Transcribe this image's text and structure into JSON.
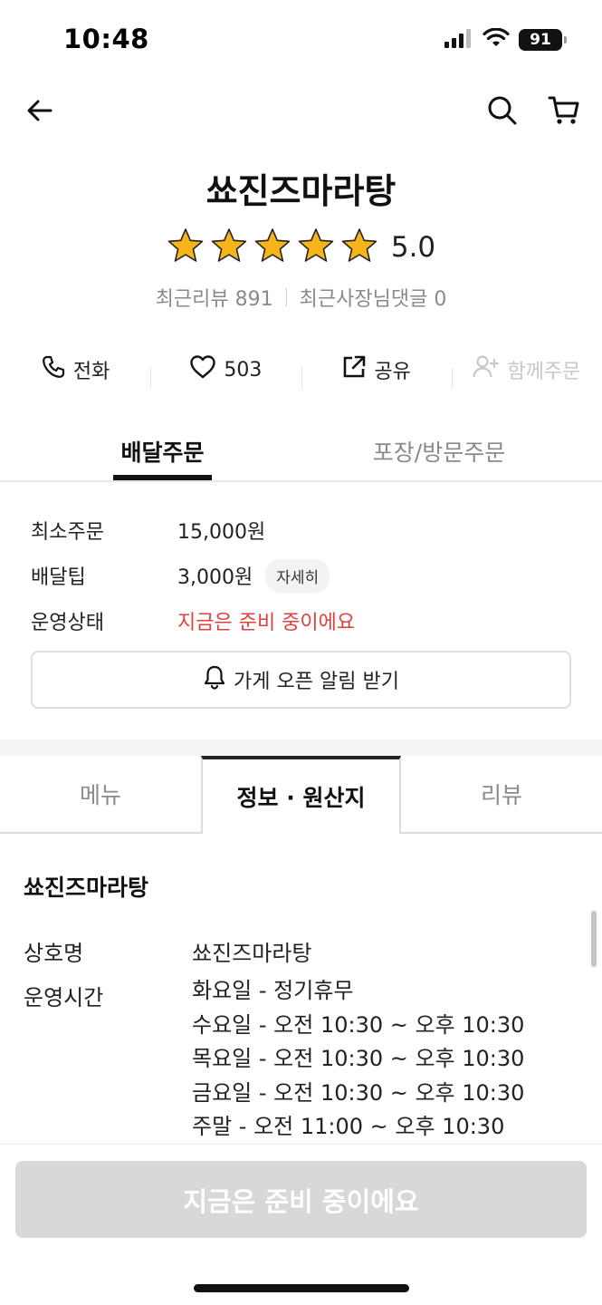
{
  "status_bar": {
    "time": "10:48",
    "battery": "91",
    "icons": [
      "signal-icon",
      "wifi-icon",
      "battery-icon"
    ]
  },
  "nav": {
    "icons": [
      "back-arrow-icon",
      "search-icon",
      "cart-icon"
    ]
  },
  "store": {
    "name": "쑈진즈마라탕",
    "rating": "5.0",
    "stars": 5,
    "recent_reviews_label": "최근리뷰 891",
    "owner_replies_label": "최근사장님댓글 0"
  },
  "actions": {
    "call": "전화",
    "likes": "503",
    "share": "공유",
    "group_order": "함께주문"
  },
  "order_tabs": {
    "delivery": "배달주문",
    "pickup": "포장/방문주문"
  },
  "order_info": {
    "min_order_label": "최소주문",
    "min_order_value": "15,000원",
    "delivery_tip_label": "배달팁",
    "delivery_tip_value": "3,000원",
    "detail_chip": "자세히",
    "status_label": "운영상태",
    "status_value": "지금은 준비 중이에요",
    "notify_button": "가게 오픈 알림 받기"
  },
  "content_tabs": {
    "menu": "메뉴",
    "info": "정보 · 원산지",
    "review": "리뷰"
  },
  "info_section": {
    "title": "쑈진즈마라탕",
    "business_name_label": "상호명",
    "business_name_value": "쑈진즈마라탕",
    "hours_label": "운영시간",
    "hours": [
      "화요일 - 정기휴무",
      "수요일 - 오전 10:30 ~ 오후 10:30",
      "목요일 - 오전 10:30 ~ 오후 10:30",
      "금요일 - 오전 10:30 ~ 오후 10:30",
      "주말 - 오전 11:00 ~ 오후 10:30"
    ]
  },
  "bottom_cta": {
    "label": "지금은 준비 중이에요"
  },
  "colors": {
    "accent_red": "#e0413c",
    "star_yellow": "#f7b51c",
    "disabled_gray": "#d6d8da"
  }
}
